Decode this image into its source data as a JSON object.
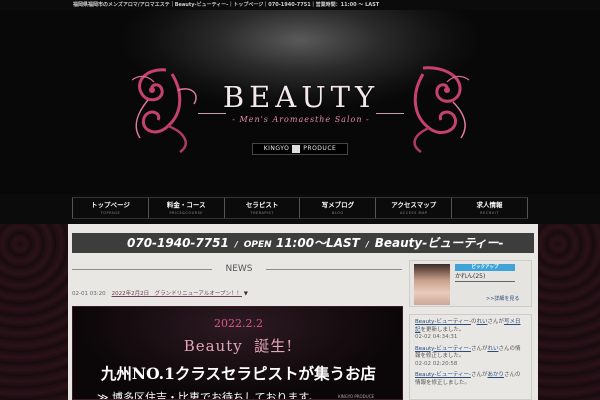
{
  "topbar": {
    "text": "福岡県福岡市のメンズアロマ/アロマエステ｜Beauty-ビューティー-｜トップページ｜070-1940-7751｜営業時間：11:00 〜 LAST"
  },
  "logo": {
    "title": "BEAUTY",
    "subtitle": "- Men's Aromaesthe Salon -",
    "brand_left": "KINGYO",
    "brand_right": "PRODUCE"
  },
  "nav": {
    "items": [
      {
        "jp": "トップページ",
        "en": "TOPPAGE"
      },
      {
        "jp": "料金・コース",
        "en": "PRICE&COURSE"
      },
      {
        "jp": "セラピスト",
        "en": "THERAPIST"
      },
      {
        "jp": "写メブログ",
        "en": "BLOG"
      },
      {
        "jp": "アクセスマップ",
        "en": "ACCESS MAP"
      },
      {
        "jp": "求人情報",
        "en": "RECRUIT"
      }
    ]
  },
  "info": {
    "phone": "070-1940-7751",
    "slash": "/",
    "open_label": "OPEN",
    "hours": "11:00〜LAST",
    "shop": "Beauty-ビューティー-"
  },
  "news": {
    "heading": "NEWS",
    "items": [
      {
        "date": "02-01 03:20",
        "title": "2022年2月2日　グランドリニューアルオープン！！",
        "arrow": "▼"
      }
    ]
  },
  "banner": {
    "date": "2022.2.2",
    "line2_a": "Beauty",
    "line2_b": "誕生!",
    "main": "九州NO.1クラスセラピストが集うお店",
    "sub": "≫ 博多区住吉・比恵でお待ちしております。",
    "badge": "KINGYO PRODUCE"
  },
  "pickup": {
    "badge": "ピックアップ",
    "name": "かれん(25)",
    "more": ">>詳細を見る"
  },
  "activity": [
    {
      "shop": "Beauty-ビューティー-",
      "mid": "の",
      "who": "れい",
      "tail": "さんが",
      "action": "写メ日記",
      "end": "を更新しました。",
      "time": "02-02 04:34:31"
    },
    {
      "shop": "Beauty-ビューティー-",
      "mid": "さんが",
      "who": "れい",
      "tail": "さんの",
      "action": "",
      "end": "情報を修正しました。",
      "time": "02-02 02:20:58"
    },
    {
      "shop": "Beauty-ビューティー-",
      "mid": "さんが",
      "who": "あかり",
      "tail": "さんの",
      "action": "",
      "end": "情報を修正しました。",
      "time": ""
    }
  ],
  "colors": {
    "accent_pink": "#d54b7a",
    "info_bar": "#3d3d3d",
    "pickup_badge": "#3ea3d6",
    "link": "#2a4d7d"
  }
}
